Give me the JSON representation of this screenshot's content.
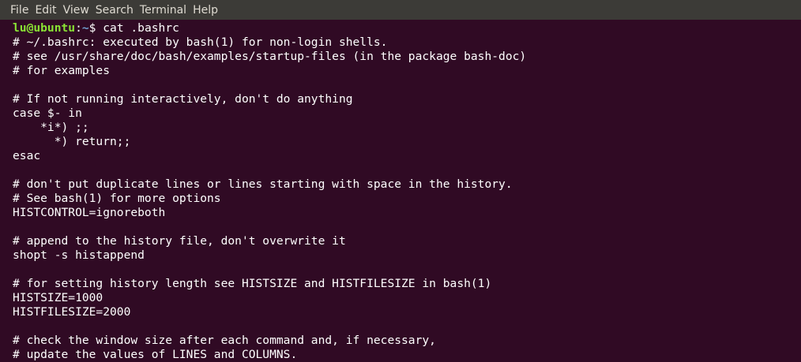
{
  "menubar": {
    "items": [
      "File",
      "Edit",
      "View",
      "Search",
      "Terminal",
      "Help"
    ]
  },
  "prompt": {
    "user_host": "lu@ubuntu",
    "colon": ":",
    "path": "~",
    "symbol": "$ ",
    "command": "cat .bashrc"
  },
  "output": [
    "# ~/.bashrc: executed by bash(1) for non-login shells.",
    "# see /usr/share/doc/bash/examples/startup-files (in the package bash-doc)",
    "# for examples",
    "",
    "# If not running interactively, don't do anything",
    "case $- in",
    "    *i*) ;;",
    "      *) return;;",
    "esac",
    "",
    "# don't put duplicate lines or lines starting with space in the history.",
    "# See bash(1) for more options",
    "HISTCONTROL=ignoreboth",
    "",
    "# append to the history file, don't overwrite it",
    "shopt -s histappend",
    "",
    "# for setting history length see HISTSIZE and HISTFILESIZE in bash(1)",
    "HISTSIZE=1000",
    "HISTFILESIZE=2000",
    "",
    "# check the window size after each command and, if necessary,",
    "# update the values of LINES and COLUMNS."
  ],
  "colors": {
    "background": "#300a24",
    "menubar": "#3c3b37",
    "prompt_user": "#8ae234",
    "prompt_path": "#729fcf",
    "text": "#ffffff"
  }
}
